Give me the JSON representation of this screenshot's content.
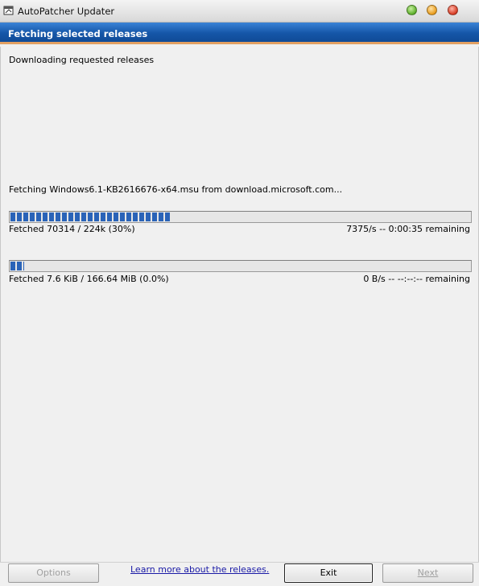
{
  "window": {
    "title": "AutoPatcher Updater"
  },
  "header": {
    "title": "Fetching selected releases"
  },
  "main": {
    "status": "Downloading requested releases",
    "fetch_line": "Fetching Windows6.1-KB2616676-x64.msu from download.microsoft.com...",
    "file_progress": {
      "percent": 35,
      "left_text": "Fetched 70314 / 224k (30%)",
      "right_text": "7375/s -- 0:00:35 remaining"
    },
    "total_progress": {
      "percent": 3,
      "left_text": "Fetched 7.6 KiB / 166.64 MiB (0.0%)",
      "right_text": "0 B/s -- --:--:-- remaining"
    }
  },
  "footer": {
    "options_label": "Options",
    "learn_more_label": "Learn more about the releases.",
    "exit_label": "Exit",
    "next_label": "Next"
  },
  "colors": {
    "header_blue": "#1556a8",
    "progress_fill": "#2a63b8",
    "link": "#1a1aa6"
  },
  "icons": [
    "app-window-icon",
    "minimize-icon",
    "maximize-icon",
    "close-icon"
  ]
}
